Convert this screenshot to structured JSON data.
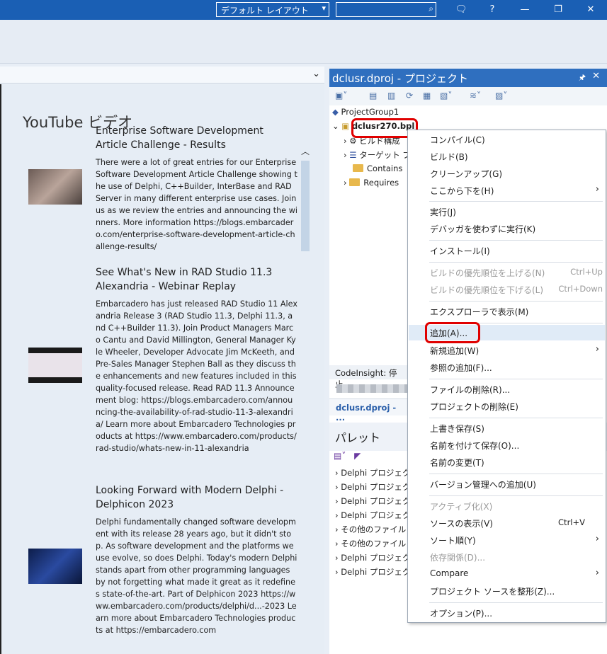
{
  "titlebar": {
    "layout_select": "デフォルト レイアウト",
    "search_placeholder": "",
    "help_label": "?"
  },
  "welcome": {
    "section_title": "YouTube ビデオ",
    "videos": [
      {
        "title": "Enterprise Software Development Article Challenge - Results",
        "description": "There were a lot of great entries for our Enterprise Software Development Article Challenge showing the use of Delphi, C++Builder, InterBase and RAD Server in many different enterprise use cases. Join us as we review the entries and announcing the winners. More information https://blogs.embarcadero.com/enterprise-software-development-article-challenge-results/"
      },
      {
        "title": "See What's New in RAD Studio 11.3 Alexandria - Webinar Replay",
        "description": "Embarcadero has just released RAD Studio 11 Alexandria Release 3 (RAD Studio 11.3, Delphi 11.3, and C++Builder 11.3). Join Product Managers Marco Cantu and David Millington, General Manager Kyle Wheeler, Developer Advocate Jim McKeeth, and Pre-Sales Manager Stephen Ball as they discuss the enhancements and new features included in this quality-focused release. Read RAD 11.3 Announcement blog: https://blogs.embarcadero.com/announcing-the-availability-of-rad-studio-11-3-alexandria/ Learn more about Embarcadero Technologies products at https://www.embarcadero.com/products/rad-studio/whats-new-in-11-alexandria"
      },
      {
        "title": "Looking Forward with Modern Delphi - Delphicon 2023",
        "description": "Delphi fundamentally changed software development with its release 28 years ago, but it didn't stop. As software development and the platforms we use evolve, so does Delphi. Today's modern Delphi stands apart from other programming languages by not forgetting what made it great as it redefines state-of-the-art. Part of Delphicon 2023 https://www.embarcadero.com/products/delphi/d...-2023 Learn more about Embarcadero Technologies products at https://embarcadero.com"
      }
    ]
  },
  "project": {
    "title": "dclusr.dproj - プロジェクト",
    "tree": {
      "group": "ProjectGroup1",
      "project": "dclusr270.bpl",
      "children": [
        "ビルド構成",
        "ターゲット プ",
        "Contains",
        "Requires"
      ]
    },
    "status": "CodeInsight: 停止",
    "tab": "dclusr.dproj - ..."
  },
  "palette": {
    "title": "パレット",
    "items": [
      "Delphi プロジェクト",
      "Delphi プロジェクト",
      "Delphi プロジェクト",
      "Delphi プロジェクト",
      "その他のファイル",
      "その他のファイル",
      "Delphi プロジェクト",
      "Delphi プロジェクト"
    ]
  },
  "menu": {
    "items": [
      {
        "label": "コンパイル(C)"
      },
      {
        "label": "ビルド(B)"
      },
      {
        "label": "クリーンアップ(G)"
      },
      {
        "label": "ここから下を(H)"
      },
      {
        "label": "実行(J)"
      },
      {
        "label": "デバッガを使わずに実行(K)"
      },
      {
        "label": "インストール(I)"
      },
      {
        "label": "ビルドの優先順位を上げる(N)",
        "shortcut": "Ctrl+Up"
      },
      {
        "label": "ビルドの優先順位を下げる(L)",
        "shortcut": "Ctrl+Down"
      },
      {
        "label": "エクスプローラで表示(M)"
      },
      {
        "label": "追加(A)..."
      },
      {
        "label": "新規追加(W)"
      },
      {
        "label": "参照の追加(F)..."
      },
      {
        "label": "ファイルの削除(R)..."
      },
      {
        "label": "プロジェクトの削除(E)"
      },
      {
        "label": "上書き保存(S)"
      },
      {
        "label": "名前を付けて保存(O)..."
      },
      {
        "label": "名前の変更(T)"
      },
      {
        "label": "バージョン管理への追加(U)"
      },
      {
        "label": "アクティブ化(X)"
      },
      {
        "label": "ソースの表示(V)",
        "shortcut": "Ctrl+V"
      },
      {
        "label": "ソート順(Y)"
      },
      {
        "label": "依存関係(D)..."
      },
      {
        "label": "Compare"
      },
      {
        "label": "プロジェクト ソースを整形(Z)..."
      },
      {
        "label": "オプション(P)..."
      }
    ]
  },
  "colors": {
    "titlebar": "#1a5fb4",
    "panel_header": "#2f6fbf",
    "highlight": "#e00000"
  }
}
